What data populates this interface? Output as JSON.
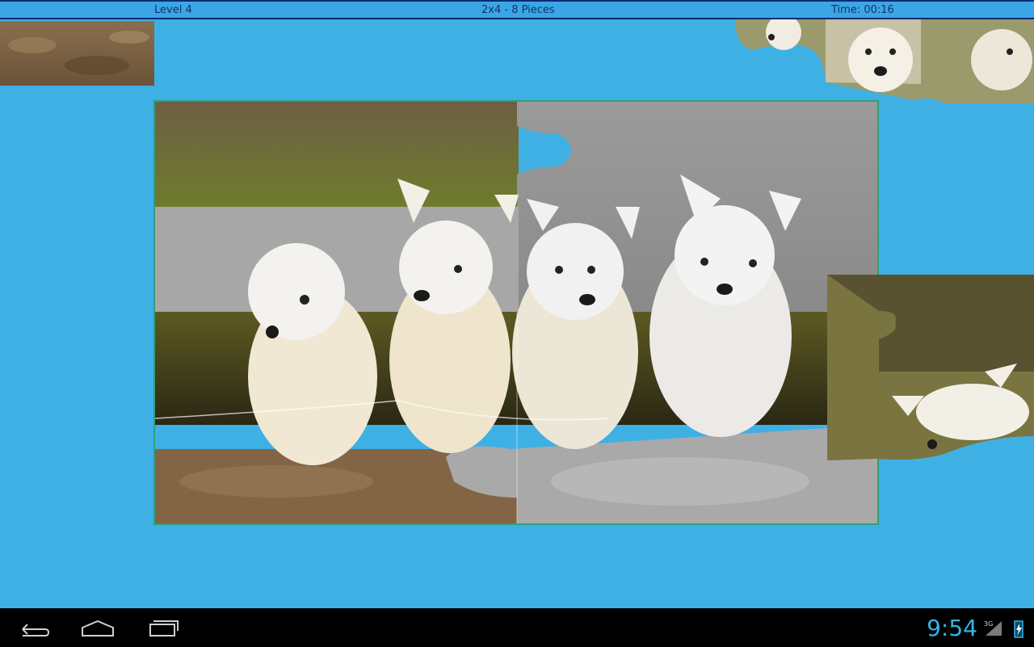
{
  "header": {
    "level": "Level 4",
    "pieces": "2x4 - 8 Pieces",
    "time": "Time: 00:16"
  },
  "statusbar": {
    "clock": "9:54",
    "network": "3G"
  },
  "icons": {
    "back": "back-icon",
    "home": "home-icon",
    "recents": "recent-apps-icon",
    "signal": "signal-icon",
    "battery": "battery-charging-icon"
  },
  "colors": {
    "background": "#3fb0e4",
    "header_bar": "#3aa6e6",
    "header_border": "#0b2a6e",
    "board_border": "#2fa07c",
    "clock": "#33b5e5"
  }
}
